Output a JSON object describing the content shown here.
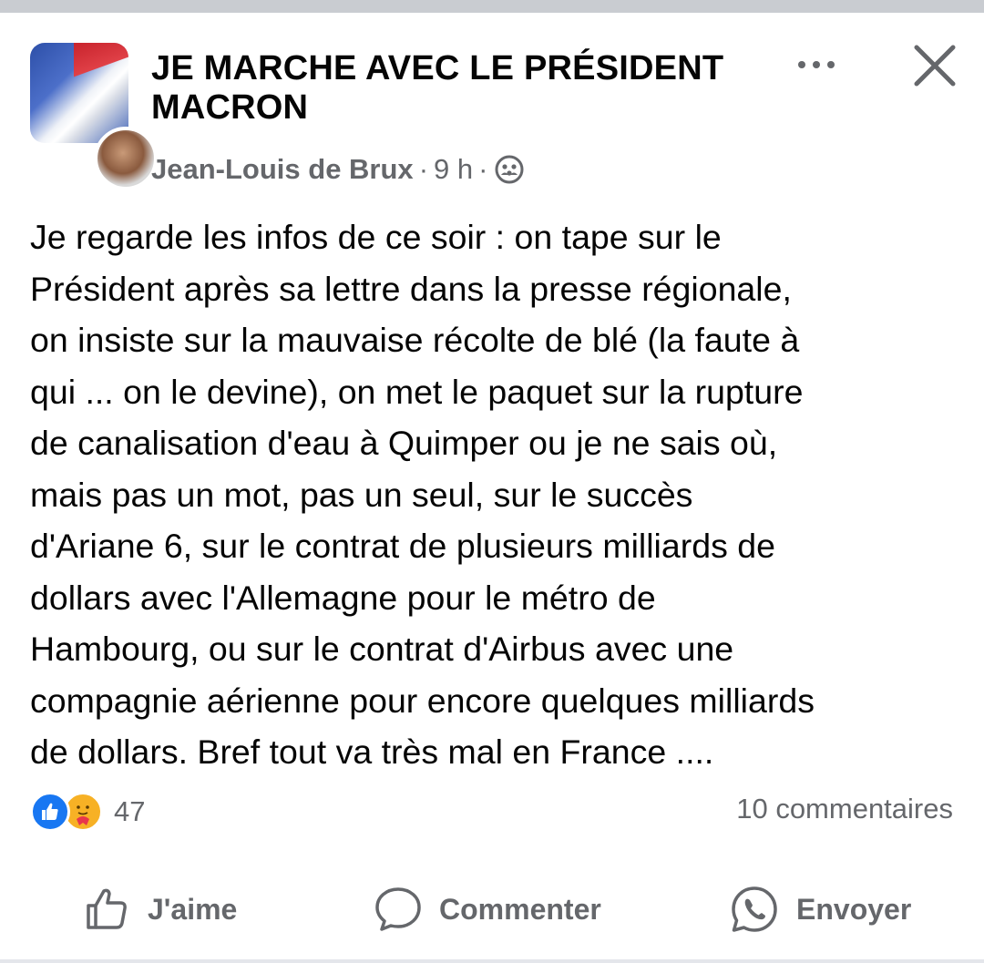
{
  "post": {
    "group_name": "JE MARCHE AVEC LE PRÉSIDENT MACRON",
    "author": "Jean-Louis de Brux",
    "separator": "·",
    "time": "9 h",
    "audience_icon": "group-members-icon",
    "text_lines": [
      "Je regarde les infos de ce soir : on tape sur le",
      "Président après sa lettre dans la presse régionale,",
      "on insiste sur la mauvaise récolte de blé (la faute à",
      "qui ... on le devine), on met le paquet sur la rupture",
      "de canalisation d'eau à Quimper ou je ne sais où,",
      "mais pas un mot, pas un seul, sur le succès",
      "d'Ariane 6, sur le contrat de plusieurs milliards de",
      "dollars avec l'Allemagne pour le métro de",
      "Hambourg, ou sur le contrat d'Airbus avec une",
      "compagnie aérienne pour encore quelques milliards",
      "de dollars. Bref tout va très mal en France ...."
    ]
  },
  "reactions": {
    "icons": [
      "like-reaction-icon",
      "care-reaction-icon"
    ],
    "count": "47",
    "comments": "10 commentaires"
  },
  "actions": {
    "like_label": "J'aime",
    "comment_label": "Commenter",
    "send_label": "Envoyer"
  },
  "colors": {
    "text": "#050505",
    "secondary_text": "#65676b",
    "like_blue": "#1877f2",
    "care_yellow": "#f7b125",
    "top_bar": "#c9ccd1"
  }
}
